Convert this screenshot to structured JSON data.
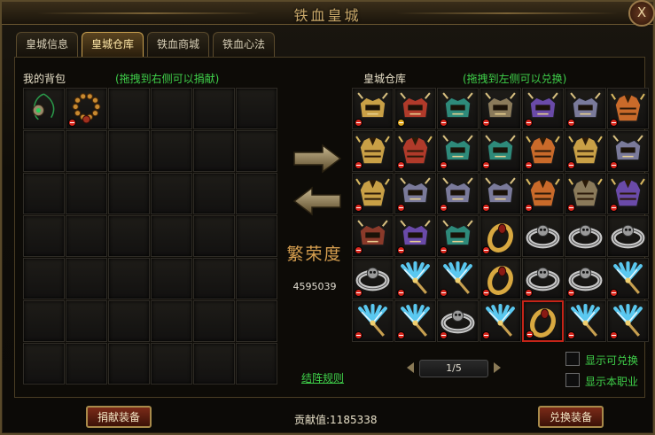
{
  "window": {
    "title": "铁血皇城",
    "close_label": "X"
  },
  "tabs": [
    {
      "label": "皇城信息",
      "active": false
    },
    {
      "label": "皇城仓库",
      "active": true
    },
    {
      "label": "铁血商城",
      "active": false
    },
    {
      "label": "铁血心法",
      "active": false
    }
  ],
  "bag": {
    "label": "我的背包",
    "hint": "(拖拽到右侧可以捐献)",
    "items": [
      {
        "icon": "pendant-icon",
        "mark": "none"
      },
      {
        "icon": "beads-necklace-icon",
        "mark": "forbidden"
      }
    ]
  },
  "warehouse": {
    "label": "皇城仓库",
    "hint": "(拖拽到左侧可以兑换)",
    "items": [
      {
        "icon": "helmet-icon",
        "color": "#c9a046",
        "mark": "forbidden"
      },
      {
        "icon": "helmet-icon",
        "color": "#b03a2a",
        "mark": "equal"
      },
      {
        "icon": "helmet-icon",
        "color": "#2e8a7a",
        "mark": "forbidden"
      },
      {
        "icon": "helmet-icon",
        "color": "#8a7a5a",
        "mark": "forbidden"
      },
      {
        "icon": "helmet-icon",
        "color": "#6a4aa8",
        "mark": "forbidden"
      },
      {
        "icon": "helmet-icon",
        "color": "#7a7a9a",
        "mark": "forbidden"
      },
      {
        "icon": "armor-icon",
        "color": "#c96a2a",
        "mark": "forbidden"
      },
      {
        "icon": "armor-icon",
        "color": "#c9a046",
        "mark": "forbidden"
      },
      {
        "icon": "armor-icon",
        "color": "#b03a2a",
        "mark": "forbidden"
      },
      {
        "icon": "helmet-icon",
        "color": "#2e8a7a",
        "mark": "forbidden"
      },
      {
        "icon": "helmet-icon",
        "color": "#2e8a7a",
        "mark": "forbidden"
      },
      {
        "icon": "armor-icon",
        "color": "#c96a2a",
        "mark": "forbidden"
      },
      {
        "icon": "armor-icon",
        "color": "#c9a046",
        "mark": "forbidden"
      },
      {
        "icon": "helmet-icon",
        "color": "#7a7a9a",
        "mark": "forbidden"
      },
      {
        "icon": "armor-icon",
        "color": "#c9a046",
        "mark": "forbidden"
      },
      {
        "icon": "helmet-icon",
        "color": "#7a7a9a",
        "mark": "forbidden"
      },
      {
        "icon": "helmet-icon",
        "color": "#7a7a9a",
        "mark": "forbidden"
      },
      {
        "icon": "helmet-icon",
        "color": "#7a7a9a",
        "mark": "forbidden"
      },
      {
        "icon": "armor-icon",
        "color": "#c96a2a",
        "mark": "forbidden"
      },
      {
        "icon": "armor-icon",
        "color": "#8a7a5a",
        "mark": "forbidden"
      },
      {
        "icon": "armor-icon",
        "color": "#6a4aa8",
        "mark": "forbidden"
      },
      {
        "icon": "helmet-icon",
        "color": "#8a3a2a",
        "mark": "forbidden"
      },
      {
        "icon": "helmet-icon",
        "color": "#6a4aa8",
        "mark": "forbidden"
      },
      {
        "icon": "helmet-icon",
        "color": "#2e8a7a",
        "mark": "forbidden"
      },
      {
        "icon": "gold-ring-icon",
        "color": "#d8a840",
        "mark": "forbidden"
      },
      {
        "icon": "silver-ring-icon",
        "color": "#c8c8c8",
        "mark": "none"
      },
      {
        "icon": "silver-ring-icon",
        "color": "#c8c8c8",
        "mark": "none"
      },
      {
        "icon": "silver-ring-icon",
        "color": "#c8c8c8",
        "mark": "none"
      },
      {
        "icon": "silver-ring-icon",
        "color": "#c8c8c8",
        "mark": "forbidden"
      },
      {
        "icon": "crystal-scepter-icon",
        "color": "#5ac8f0",
        "mark": "forbidden"
      },
      {
        "icon": "crystal-scepter-icon",
        "color": "#5ac8f0",
        "mark": "forbidden"
      },
      {
        "icon": "gold-ring-icon",
        "color": "#d8a840",
        "mark": "forbidden"
      },
      {
        "icon": "silver-ring-icon",
        "color": "#c8c8c8",
        "mark": "forbidden"
      },
      {
        "icon": "silver-ring-icon",
        "color": "#c8c8c8",
        "mark": "forbidden"
      },
      {
        "icon": "crystal-scepter-icon",
        "color": "#5ac8f0",
        "mark": "forbidden"
      },
      {
        "icon": "crystal-scepter-icon",
        "color": "#5ac8f0",
        "mark": "forbidden"
      },
      {
        "icon": "crystal-scepter-icon",
        "color": "#5ac8f0",
        "mark": "forbidden"
      },
      {
        "icon": "silver-ring-icon",
        "color": "#c8c8c8",
        "mark": "forbidden"
      },
      {
        "icon": "crystal-scepter-icon",
        "color": "#5ac8f0",
        "mark": "forbidden"
      },
      {
        "icon": "gold-ring-icon",
        "color": "#d8a840",
        "mark": "forbidden",
        "selected": true
      },
      {
        "icon": "crystal-scepter-icon",
        "color": "#5ac8f0",
        "mark": "forbidden"
      },
      {
        "icon": "crystal-scepter-icon",
        "color": "#5ac8f0",
        "mark": "forbidden"
      }
    ]
  },
  "prosperity": {
    "label": "繁荣度",
    "value": "4595039"
  },
  "formation_rules": "结阵规则",
  "pager": {
    "text": "1/5"
  },
  "filters": [
    {
      "label": "显示可兑换",
      "checked": false
    },
    {
      "label": "显示本职业",
      "checked": false
    }
  ],
  "footer": {
    "donate_label": "捐献装备",
    "contribution_text": "贡献值:1185338",
    "exchange_label": "兑换装备"
  },
  "colors": {
    "hint_green": "#3fd04a",
    "gold_text": "#d8a050",
    "selected_border": "#c42418"
  }
}
